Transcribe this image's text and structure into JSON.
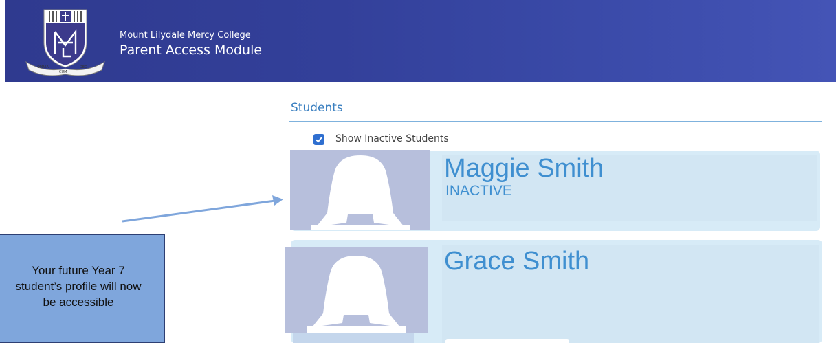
{
  "header": {
    "school_name": "Mount Lilydale Mercy College",
    "module_name": "Parent Access Module",
    "crest_motto": "OMNIA CUM DEO"
  },
  "students_section": {
    "heading": "Students",
    "show_inactive_label": "Show Inactive Students",
    "show_inactive_checked": true,
    "students": [
      {
        "name": "Maggie Smith",
        "status": "INACTIVE"
      },
      {
        "name": "Grace Smith",
        "status": ""
      }
    ]
  },
  "annotation": {
    "callout_lines": [
      "Your future Year 7",
      "student’s profile will now",
      "be accessible"
    ]
  },
  "colors": {
    "header_bg": "#33409a",
    "accent_text": "#3f8fd0",
    "card_bg": "#d7ebf7",
    "avatar_bg": "#b7bfdc",
    "callout_bg": "#7fa6dc",
    "checkbox": "#2f6fd0"
  }
}
